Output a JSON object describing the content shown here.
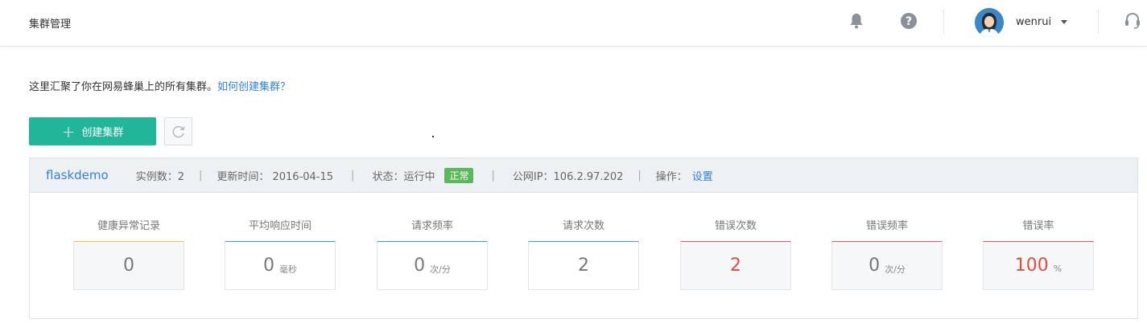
{
  "header": {
    "title": "集群管理",
    "username": "wenrui"
  },
  "intro": {
    "text": "这里汇聚了你在网易蜂巢上的所有集群。",
    "link": "如何创建集群？"
  },
  "toolbar": {
    "create_label": "创建集群"
  },
  "cluster": {
    "name": "flaskdemo",
    "instances": "实例数：2",
    "updated": "更新时间： 2016-04-15",
    "status_label": "状态：运行中",
    "status_badge": "正常",
    "public_ip": "公网IP：106.2.97.202",
    "ops_label": "操作：",
    "ops_link": "设置",
    "separator": "|"
  },
  "metrics": [
    {
      "label": "健康异常记录",
      "value": "0",
      "unit": "",
      "accent": "#f0c24a",
      "value_color": "normal"
    },
    {
      "label": "平均响应时间",
      "value": "0",
      "unit": "毫秒",
      "accent": "#2fa5c9",
      "value_color": "normal"
    },
    {
      "label": "请求频率",
      "value": "0",
      "unit": "次/分",
      "accent": "#2fa5c9",
      "value_color": "normal"
    },
    {
      "label": "请求次数",
      "value": "2",
      "unit": "",
      "accent": "#2fa5c9",
      "value_color": "normal"
    },
    {
      "label": "错误次数",
      "value": "2",
      "unit": "",
      "accent": "#e0575a",
      "value_color": "red"
    },
    {
      "label": "错误频率",
      "value": "0",
      "unit": "次/分",
      "accent": "#e0575a",
      "value_color": "normal"
    },
    {
      "label": "错误率",
      "value": "100",
      "unit": "%",
      "accent": "#e0575a",
      "value_color": "red"
    }
  ],
  "colors": {
    "primary": "#21b59a",
    "link": "#2f83d6",
    "badge_ok": "#5cb85c",
    "error": "#e84b3c"
  }
}
